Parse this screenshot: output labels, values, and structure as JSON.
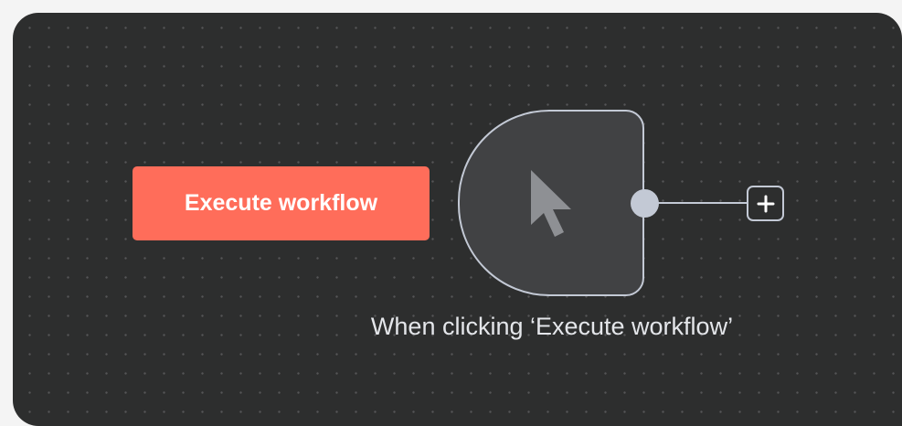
{
  "canvas": {
    "background_color": "#2d2e2e",
    "dot_color": "#555657"
  },
  "execute_button": {
    "label": "Execute workflow",
    "color": "#ff6d5a"
  },
  "trigger_node": {
    "icon": "mouse-pointer-icon",
    "label": "When clicking ‘Execute workflow’",
    "node_color": "#414244",
    "border_color": "#c3c9d5"
  },
  "add_node": {
    "icon": "plus-icon"
  }
}
